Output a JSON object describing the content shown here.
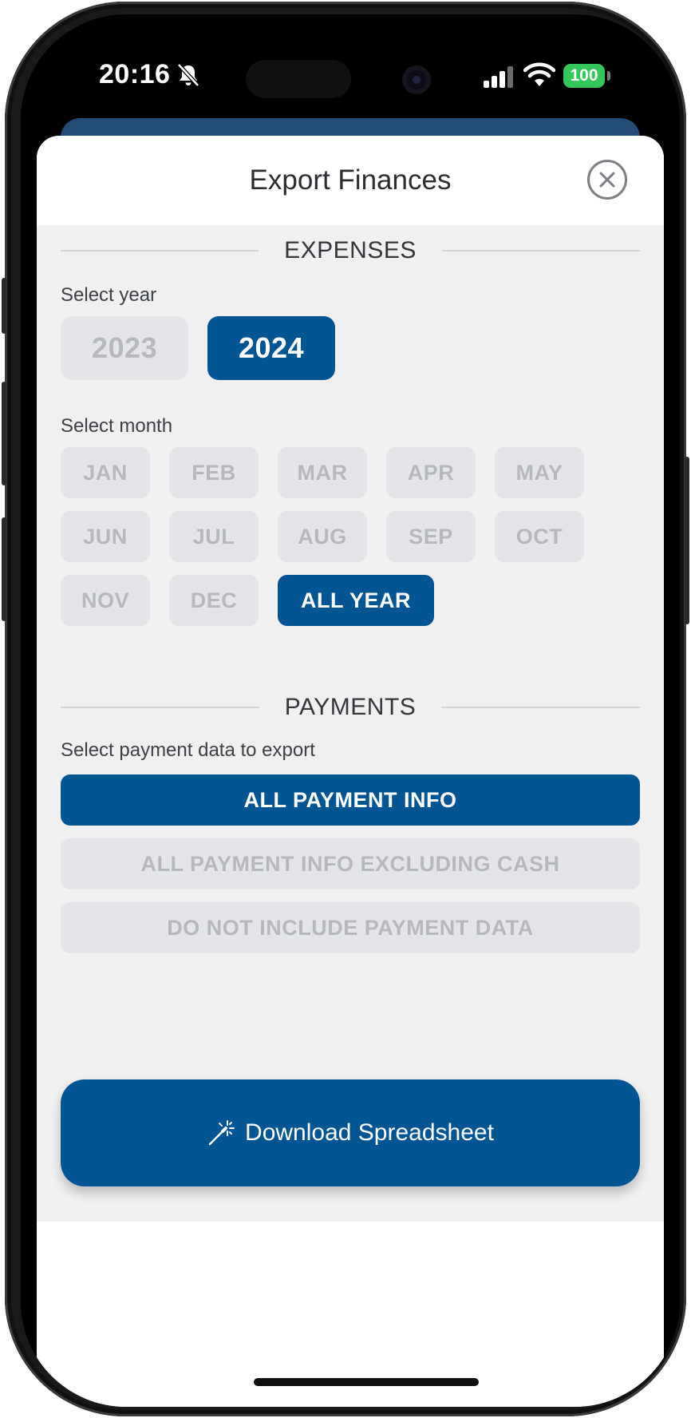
{
  "status_bar": {
    "time": "20:16",
    "battery": "100",
    "icons": [
      "bell-slash-icon",
      "signal-icon",
      "wifi-icon",
      "battery-icon"
    ]
  },
  "sheet": {
    "title": "Export Finances",
    "close_icon": "close-circle-icon"
  },
  "expenses": {
    "heading": "EXPENSES",
    "year_label": "Select year",
    "years": [
      {
        "label": "2023",
        "selected": false
      },
      {
        "label": "2024",
        "selected": true
      }
    ],
    "month_label": "Select month",
    "months": [
      {
        "label": "JAN",
        "selected": false
      },
      {
        "label": "FEB",
        "selected": false
      },
      {
        "label": "MAR",
        "selected": false
      },
      {
        "label": "APR",
        "selected": false
      },
      {
        "label": "MAY",
        "selected": false
      },
      {
        "label": "JUN",
        "selected": false
      },
      {
        "label": "JUL",
        "selected": false
      },
      {
        "label": "AUG",
        "selected": false
      },
      {
        "label": "SEP",
        "selected": false
      },
      {
        "label": "OCT",
        "selected": false
      },
      {
        "label": "NOV",
        "selected": false
      },
      {
        "label": "DEC",
        "selected": false
      },
      {
        "label": "ALL YEAR",
        "selected": true
      }
    ]
  },
  "payments": {
    "heading": "PAYMENTS",
    "label": "Select payment data to export",
    "options": [
      {
        "label": "ALL PAYMENT INFO",
        "selected": true
      },
      {
        "label": "ALL PAYMENT INFO EXCLUDING CASH",
        "selected": false
      },
      {
        "label": "DO NOT INCLUDE PAYMENT DATA",
        "selected": false
      }
    ]
  },
  "download": {
    "label": "Download Spreadsheet",
    "icon": "magic-wand-icon"
  },
  "colors": {
    "primary": "#015593",
    "chip_inactive_bg": "#e4e5e8",
    "chip_inactive_text": "#b5b8be",
    "battery_green": "#34c759"
  }
}
